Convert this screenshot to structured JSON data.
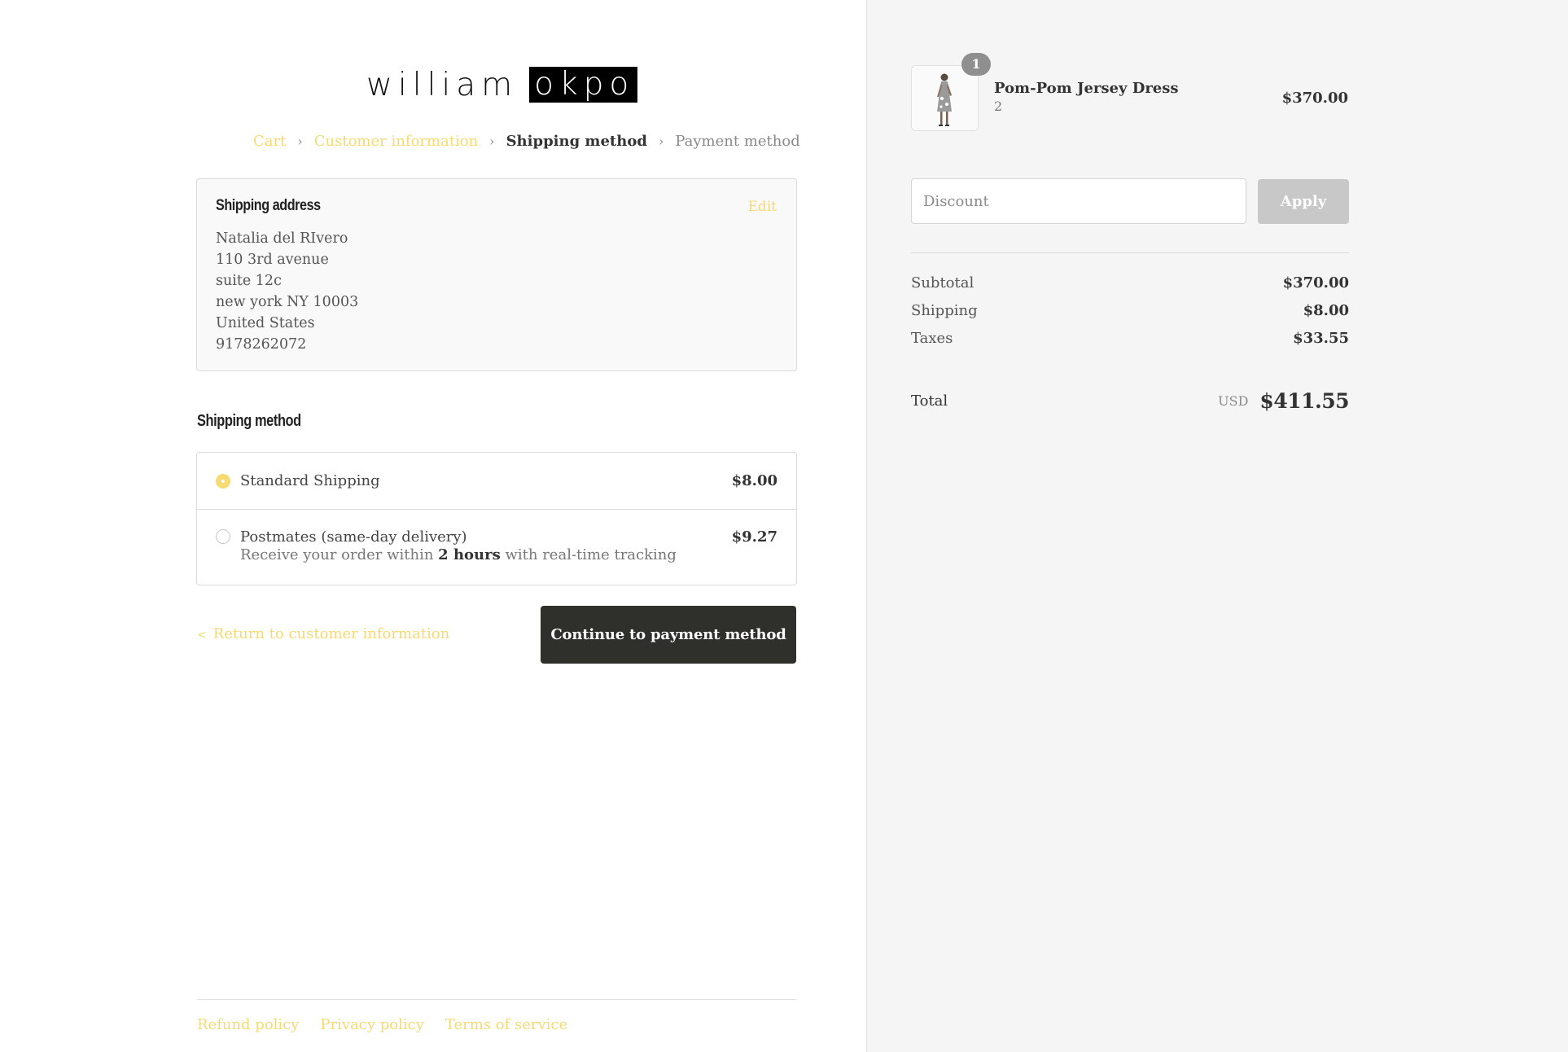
{
  "logo": {
    "part1": "william",
    "part2": "okpo"
  },
  "breadcrumb": {
    "items": [
      "Cart",
      "Customer information",
      "Shipping method",
      "Payment method"
    ],
    "separator": "›"
  },
  "shipping_address": {
    "title": "Shipping address",
    "edit_label": "Edit",
    "lines": [
      "Natalia del RIvero",
      "110 3rd avenue",
      "suite 12c",
      "new york NY 10003",
      "United States",
      "9178262072"
    ]
  },
  "shipping_method": {
    "title": "Shipping method",
    "options": [
      {
        "name": "Standard Shipping",
        "price": "$8.00",
        "selected": true
      },
      {
        "name": "Postmates (same-day delivery)",
        "desc_before": "Receive your order within ",
        "desc_bold": "2 hours",
        "desc_after": " with real-time tracking",
        "price": "$9.27",
        "selected": false
      }
    ]
  },
  "actions": {
    "return_label": "Return to customer information",
    "continue_label": "Continue to payment method"
  },
  "footer": {
    "links": [
      "Refund policy",
      "Privacy policy",
      "Terms of service"
    ]
  },
  "order": {
    "product": {
      "name": "Pom-Pom Jersey Dress",
      "variant": "2",
      "price": "$370.00",
      "quantity": "1"
    },
    "discount": {
      "placeholder": "Discount",
      "apply_label": "Apply"
    },
    "summary": [
      {
        "label": "Subtotal",
        "value": "$370.00"
      },
      {
        "label": "Shipping",
        "value": "$8.00"
      },
      {
        "label": "Taxes",
        "value": "$33.55"
      }
    ],
    "total": {
      "label": "Total",
      "currency": "USD",
      "amount": "$411.55"
    }
  },
  "colors": {
    "accent": "#f6da72",
    "button_dark": "#2f2f2b",
    "sidebar_bg": "#f5f5f5"
  }
}
